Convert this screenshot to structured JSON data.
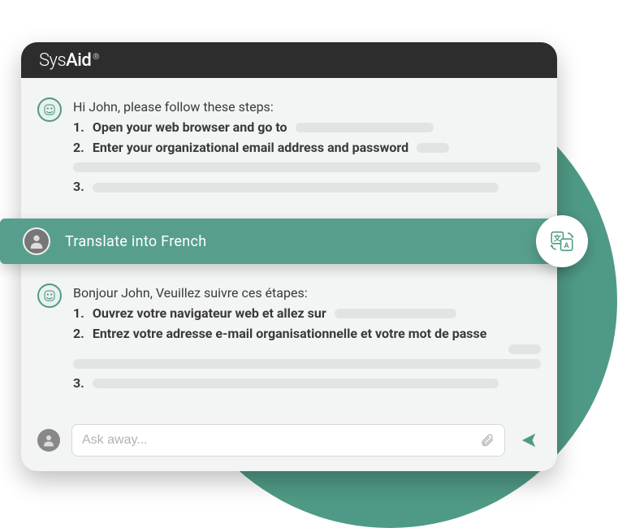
{
  "brand": {
    "sys": "Sys",
    "aid": "Aid",
    "dot": "®"
  },
  "messages": {
    "bot_en": {
      "intro": "Hi John, please follow these steps:",
      "steps": [
        {
          "num": "1.",
          "text": "Open your web browser and go to"
        },
        {
          "num": "2.",
          "text": "Enter your organizational email address and password"
        },
        {
          "num": "3.",
          "text": ""
        }
      ]
    },
    "user_prompt": "Translate into French",
    "bot_fr": {
      "intro": "Bonjour John, Veuillez suivre ces étapes:",
      "steps": [
        {
          "num": "1.",
          "text": "Ouvrez votre navigateur web et allez sur"
        },
        {
          "num": "2.",
          "text": "Entrez votre adresse e-mail organisationnelle et votre mot de passe"
        },
        {
          "num": "3.",
          "text": ""
        }
      ]
    }
  },
  "composer": {
    "placeholder": "Ask away..."
  }
}
